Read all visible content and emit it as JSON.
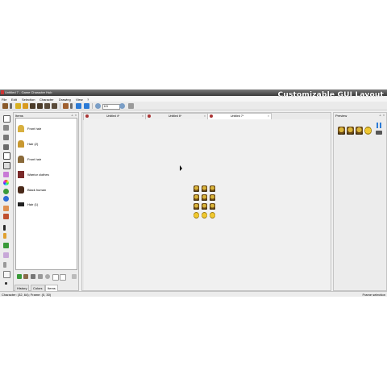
{
  "window": {
    "title": "Untitled 7 - Game Character Hub"
  },
  "banner": {
    "text": "Customizable GUI Layout"
  },
  "menu": [
    "File",
    "Edit",
    "Selection",
    "Character",
    "Drawing",
    "View",
    "?"
  ],
  "toolbar": {
    "zoom_value": "6.5",
    "colors": {
      "accent_blue": "#2c7bd6",
      "orange": "#e08a1e",
      "dark": "#4a3b2a"
    }
  },
  "items_panel": {
    "title": "Items",
    "controls": [
      "pin-icon",
      "close-icon"
    ],
    "items": [
      {
        "label": "Front hair",
        "icon": "hair-icon"
      },
      {
        "label": "Hair (2)",
        "icon": "hair-icon"
      },
      {
        "label": "Front hair",
        "icon": "hair-icon"
      },
      {
        "label": "Warrior clothes",
        "icon": "clothes-icon"
      },
      {
        "label": "Black human",
        "icon": "body-icon"
      },
      {
        "label": "Hair (1)",
        "icon": "hair-icon"
      }
    ],
    "tabs": [
      "History",
      "Colors",
      "Items"
    ],
    "active_tab": "Items"
  },
  "documents": {
    "tabs": [
      "Untitled 4*",
      "Untitled 6*",
      "Untitled 7*"
    ],
    "active": "Untitled 7*"
  },
  "preview_panel": {
    "title": "Preview",
    "controls": [
      "pin-icon",
      "close-icon"
    ],
    "pause_icon": "pause-icon"
  },
  "status": {
    "left": "Character: (32, 64); Frame: (0, 30)",
    "right": "Frame selection"
  }
}
